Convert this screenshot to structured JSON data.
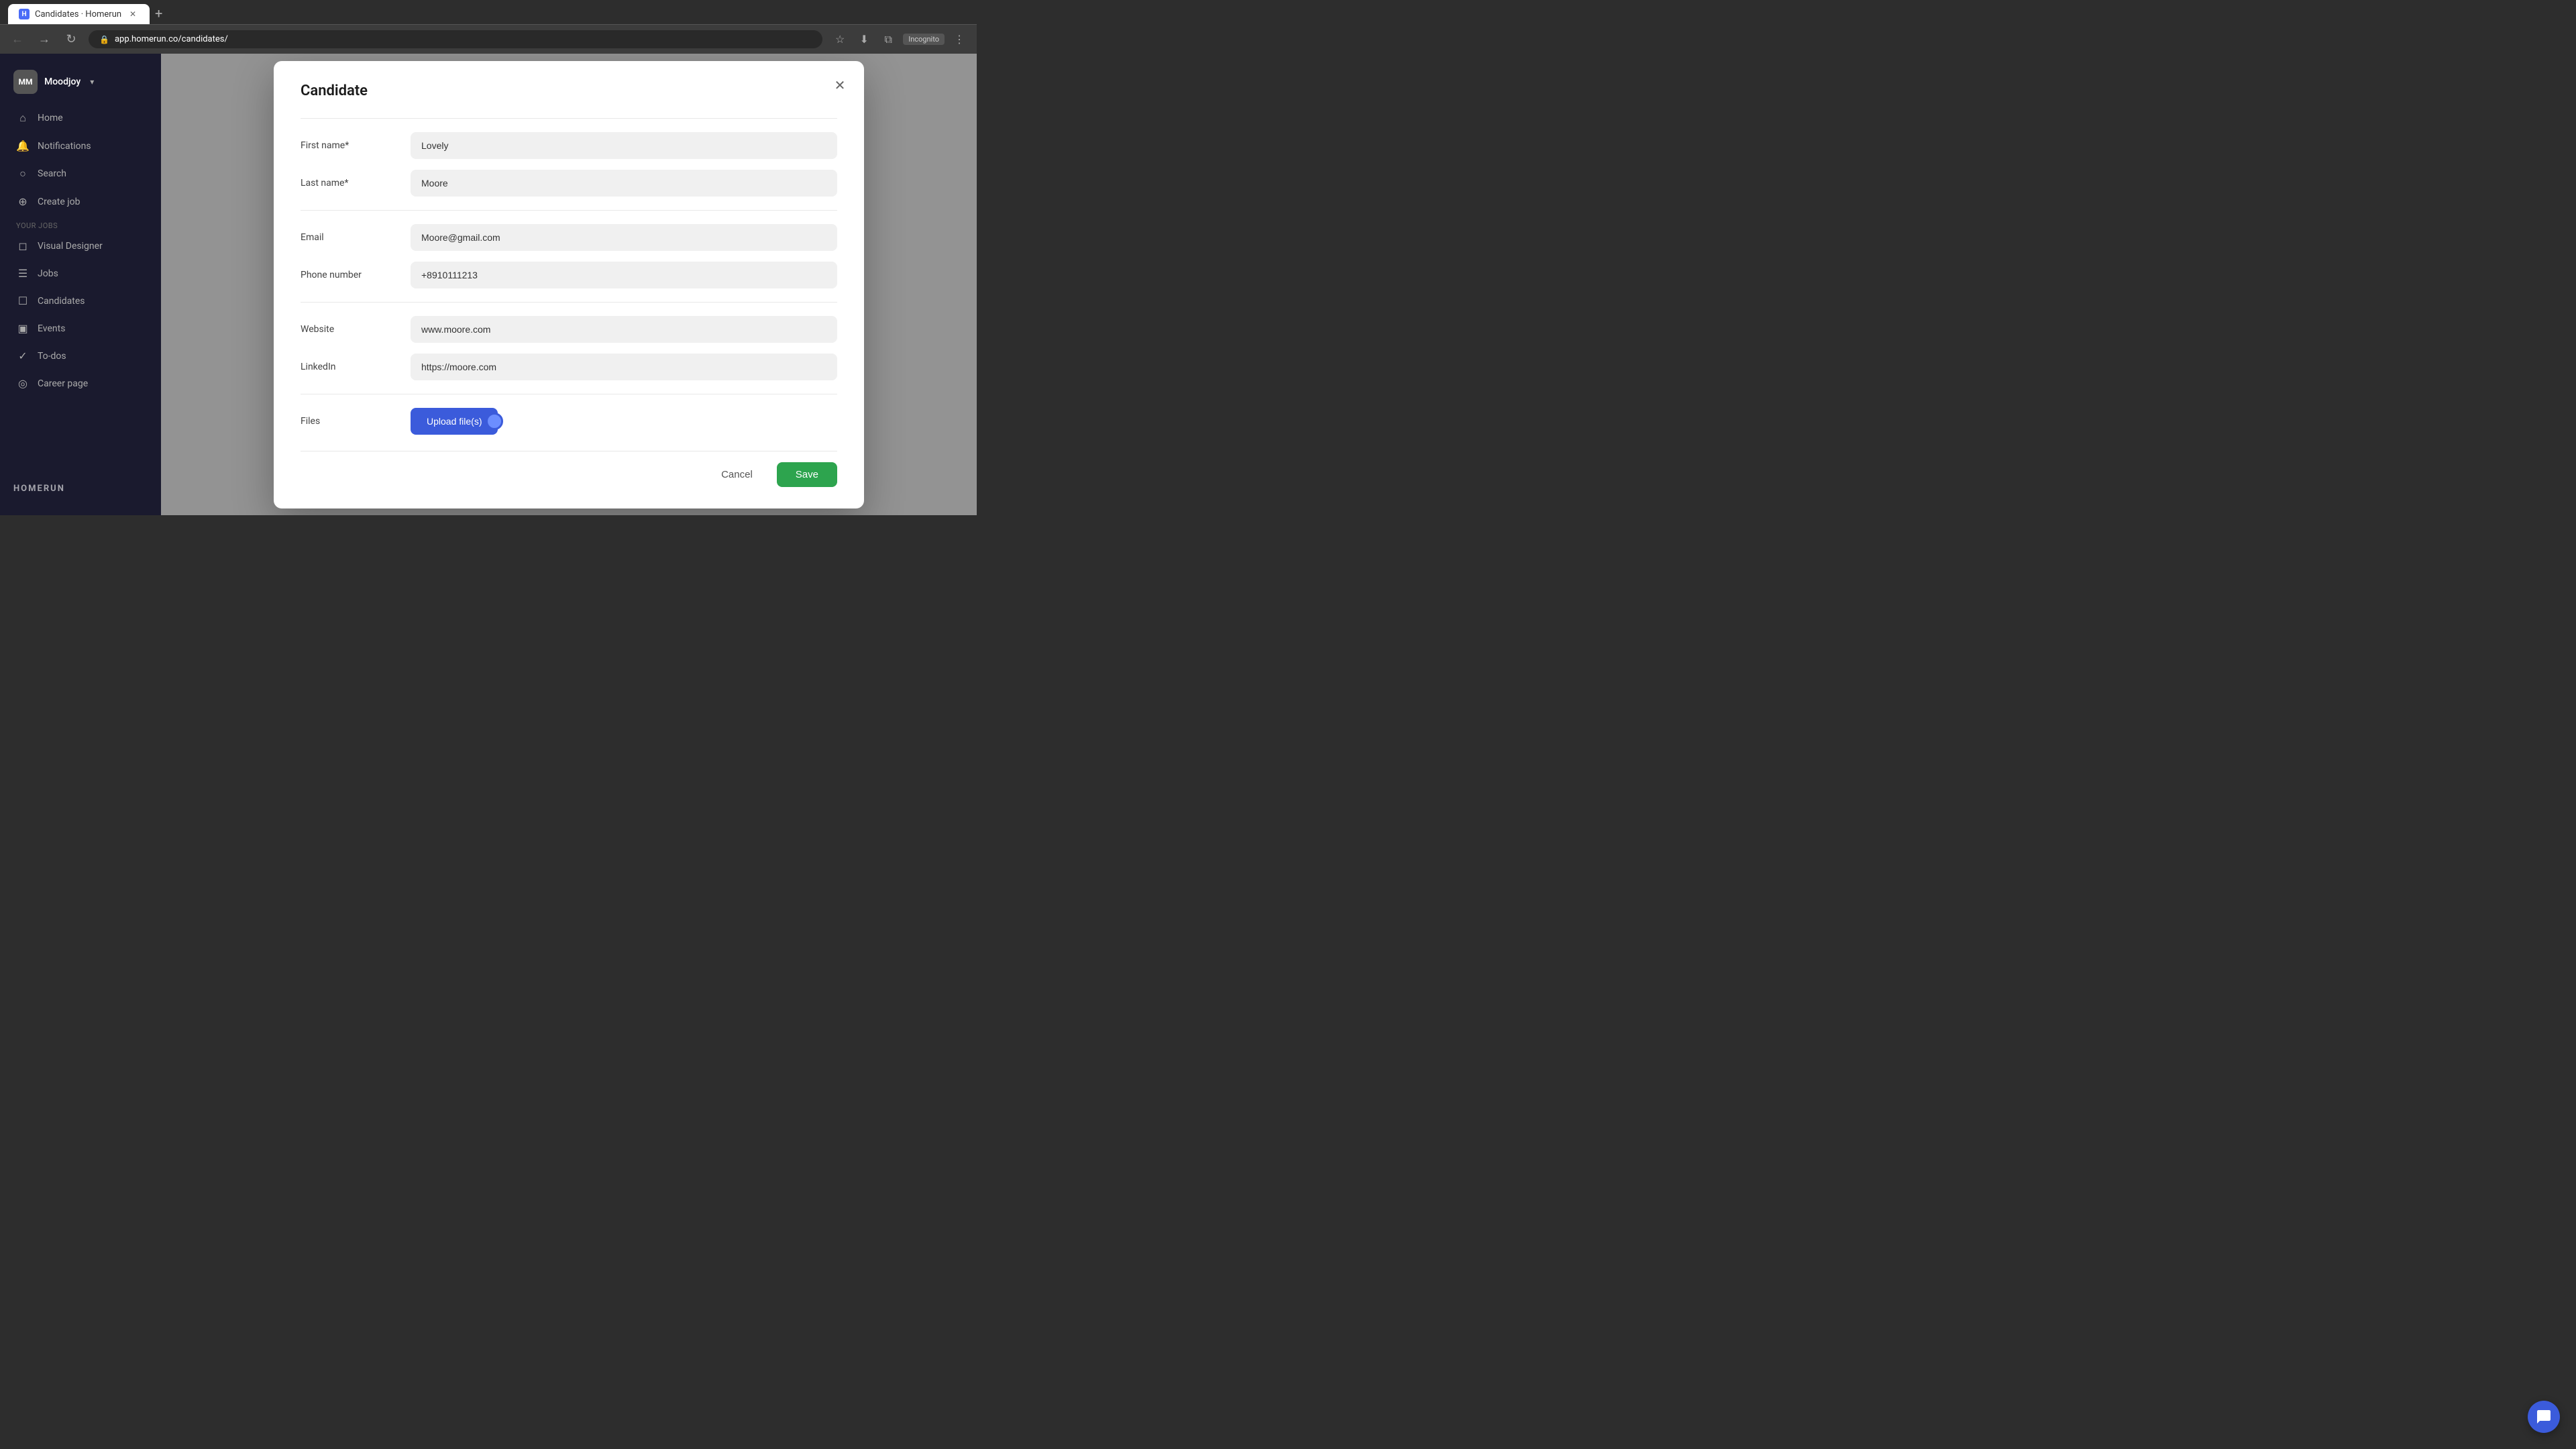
{
  "browser": {
    "tab_title": "Candidates · Homerun",
    "tab_favicon": "H",
    "url": "app.homerun.co/candidates/",
    "incognito_label": "Incognito"
  },
  "sidebar": {
    "user": {
      "initials": "MM",
      "name": "Moodjoy",
      "chevron": "▾"
    },
    "nav_items": [
      {
        "id": "home",
        "icon": "⌂",
        "label": "Home"
      },
      {
        "id": "notifications",
        "icon": "🔔",
        "label": "Notifications"
      },
      {
        "id": "search",
        "icon": "⊙",
        "label": "Search"
      },
      {
        "id": "create-job",
        "icon": "⊕",
        "label": "Create job"
      }
    ],
    "section_label": "YOUR JOBS",
    "job_items": [
      {
        "id": "visual-designer",
        "label": "Visual Designer"
      }
    ],
    "bottom_items": [
      {
        "id": "jobs",
        "icon": "☰",
        "label": "Jobs"
      },
      {
        "id": "candidates",
        "icon": "☐",
        "label": "Candidates"
      },
      {
        "id": "events",
        "icon": "📅",
        "label": "Events"
      },
      {
        "id": "to-dos",
        "icon": "✓",
        "label": "To-dos"
      },
      {
        "id": "career-page",
        "icon": "🌐",
        "label": "Career page"
      }
    ],
    "logo": "HOMERUN"
  },
  "modal": {
    "title": "Candidate",
    "fields": {
      "first_name": {
        "label": "First name",
        "required": true,
        "value": "Lovely"
      },
      "last_name": {
        "label": "Last name",
        "required": true,
        "value": "Moore"
      },
      "email": {
        "label": "Email",
        "required": false,
        "value": "Moore@gmail.com"
      },
      "phone_number": {
        "label": "Phone number",
        "required": false,
        "value": "+8910111213"
      },
      "website": {
        "label": "Website",
        "required": false,
        "value": "www.moore.com"
      },
      "linkedin": {
        "label": "LinkedIn",
        "required": false,
        "value": "https://moore.com"
      },
      "files": {
        "label": "Files",
        "upload_button": "Upload file(s)"
      }
    },
    "footer": {
      "cancel_label": "Cancel",
      "save_label": "Save"
    }
  },
  "chat": {
    "tooltip": "Open chat"
  }
}
